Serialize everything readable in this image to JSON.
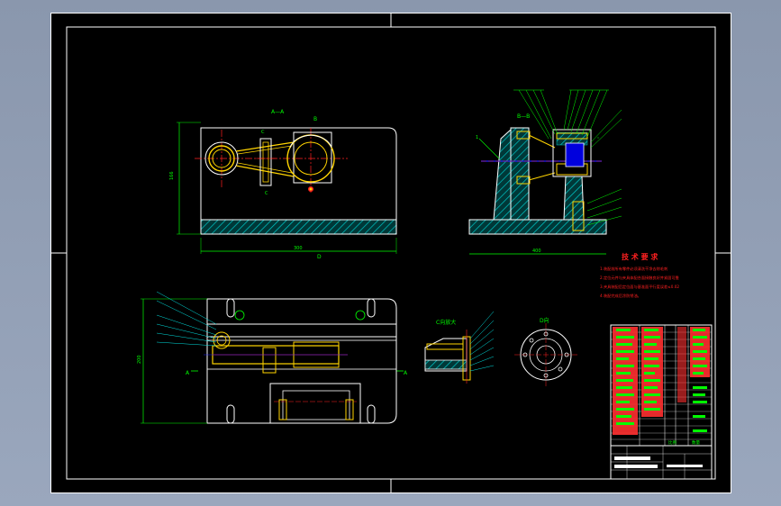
{
  "views": {
    "main_section": "A—A",
    "top_letter": "B",
    "section_c_mark": "C",
    "dim_bottom": "D",
    "side_section": "B—B",
    "plan_view": "A",
    "plan_view_right": "A",
    "c_direction": "C向放大",
    "d_direction": "D向",
    "side_mark": "1"
  },
  "tech_requirements": {
    "title": "技 术 要 求",
    "lines": [
      "1.装配前所有零件必须清洗干净去除毛刺",
      "2.定位元件与夹具体配合面接触良好并紧固可靠",
      "3.夹具装配后定位面与基准面平行度误差≤0.02",
      "4.装配完成后涂防锈油。"
    ]
  },
  "title_block": {
    "label_scale": "比例",
    "label_qty": "数量"
  },
  "colors": {
    "sheet": "#000000",
    "frame": "#ffffff",
    "part_outline": "#ffffff",
    "hatch": "#00c8c8",
    "highlight": "#ffd400",
    "center_line": "#ff2020",
    "axis": "#2020ff",
    "dimension": "#00ff00",
    "annotation": "#ff2020",
    "leader": "#00e0e0",
    "table_fill": "#ff3030",
    "table_text": "#00ff00"
  }
}
